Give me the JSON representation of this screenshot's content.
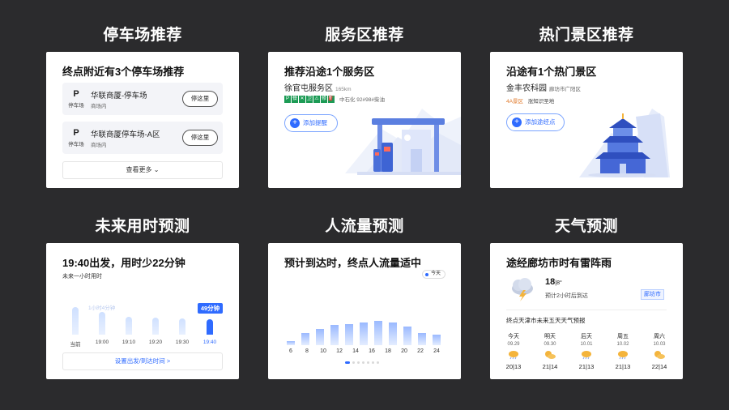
{
  "headings": {
    "parking": "停车场推荐",
    "service": "服务区推荐",
    "scenic": "热门景区推荐",
    "travel_time": "未来用时预测",
    "crowd": "人流量预测",
    "weather": "天气预测"
  },
  "parking": {
    "title": "终点附近有3个停车场推荐",
    "items": [
      {
        "p": "P",
        "type": "停车场",
        "name": "华联商厦-停车场",
        "sub": "商场内",
        "button": "停这里"
      },
      {
        "p": "P",
        "type": "停车场",
        "name": "华联商厦停车场-A区",
        "sub": "商场内",
        "button": "停这里"
      }
    ],
    "more": "查看更多 ⌄"
  },
  "service": {
    "title": "推荐沿途1个服务区",
    "name": "徐官屯服务区",
    "distance": "165km",
    "icons": [
      "P",
      "餐",
      "✕",
      "卫",
      "⚠",
      "修",
      "⛽"
    ],
    "info": "中石化 92#98#柴油",
    "button": "添加提醒"
  },
  "scenic": {
    "title": "沿途有1个热门景区",
    "name": "金丰农科园",
    "location": "廊坊市广阳区",
    "tag1": "4A景区",
    "tag2": "涨知识圣地",
    "button": "添加途经点"
  },
  "travel_time": {
    "title": "19:40出发，用时少22分钟",
    "subtitle": "未来一小时用时",
    "faint_label": "1小时4分钟",
    "badge": "49分钟",
    "button": "设置出发/到达时间 >",
    "chart_data": {
      "type": "bar",
      "categories": [
        "当前",
        "19:00",
        "19:10",
        "19:20",
        "19:30",
        "19:40"
      ],
      "values": [
        64,
        58,
        52,
        51,
        50,
        49
      ],
      "highlight": "19:40",
      "unit": "分钟"
    }
  },
  "crowd": {
    "title": "预计到达时，终点人流量适中",
    "badge": "今天",
    "chart_data": {
      "type": "bar",
      "categories": [
        "6",
        "",
        "8",
        "",
        "10",
        "",
        "12",
        "",
        "14",
        "",
        "16",
        "",
        "18",
        "",
        "20",
        "",
        "22",
        "",
        "24"
      ],
      "x_labels": [
        "6",
        "8",
        "10",
        "12",
        "14",
        "16",
        "18",
        "20",
        "22",
        "24"
      ],
      "values": [
        10,
        30,
        40,
        50,
        52,
        55,
        60,
        55,
        45,
        30,
        25
      ],
      "ylim": [
        0,
        100
      ]
    }
  },
  "weather": {
    "title": "途经廊坊市时有雷阵雨",
    "temp": "18",
    "temp_unit": "|8°",
    "desc": "预计2小时后到达",
    "city": "廊坊市",
    "forecast_title": "终点天津市未来五天天气预报",
    "days": [
      {
        "day": "今天",
        "date": "09.29",
        "range": "20|13"
      },
      {
        "day": "明天",
        "date": "09.30",
        "range": "21|14"
      },
      {
        "day": "后天",
        "date": "10.01",
        "range": "21|13"
      },
      {
        "day": "周五",
        "date": "10.02",
        "range": "21|13"
      },
      {
        "day": "周六",
        "date": "10.03",
        "range": "22|14"
      }
    ],
    "colors": {
      "sun": "#f4b43c",
      "cloud": "#c4cde0"
    }
  }
}
